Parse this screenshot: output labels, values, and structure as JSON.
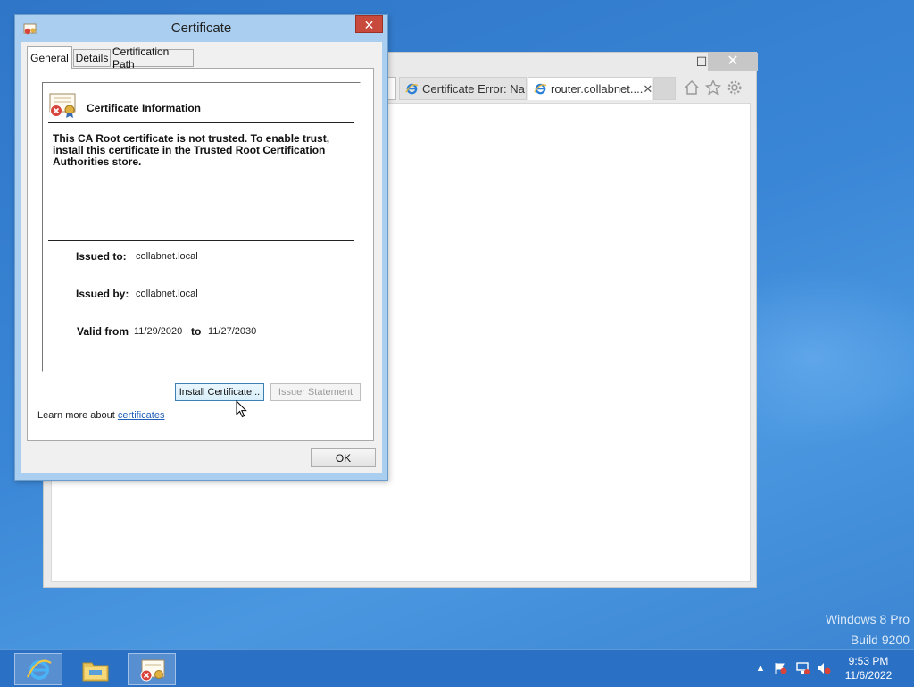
{
  "browser": {
    "tabs": [
      {
        "label": "Certificate Error: Na..."
      },
      {
        "label": "router.collabnet...."
      }
    ],
    "controls": {
      "minimize": "—",
      "maximize": "☐",
      "close": "✕"
    },
    "tab_close": "✕"
  },
  "dialog": {
    "title": "Certificate",
    "close_glyph": "✕",
    "tabs": [
      {
        "label": "General"
      },
      {
        "label": "Details"
      },
      {
        "label": "Certification Path"
      }
    ],
    "info_title": "Certificate Information",
    "info_text": "This CA Root certificate is not trusted. To enable trust, install this certificate in the Trusted Root Certification Authorities store.",
    "issued_to_label": "Issued to:",
    "issued_to_value": "collabnet.local",
    "issued_by_label": "Issued by:",
    "issued_by_value": "collabnet.local",
    "valid_from_label": "Valid from",
    "valid_from_value": "11/29/2020",
    "valid_to_label": "to",
    "valid_to_value": "11/27/2030",
    "install_button": "Install Certificate...",
    "issuer_statement_button": "Issuer Statement",
    "learn_more_prefix": "Learn more about",
    "learn_more_link": "certificates",
    "ok_button": "OK"
  },
  "watermark": {
    "line1": "Windows 8 Pro",
    "line2": "Build 9200"
  },
  "taskbar": {
    "items": [
      {
        "icon": "internet-explorer-icon"
      },
      {
        "icon": "file-explorer-icon"
      },
      {
        "icon": "certificate-app-icon"
      }
    ],
    "clock_time": "9:53 PM",
    "clock_date": "11/6/2022"
  },
  "colors": {
    "desktop": "#3a86d6",
    "taskbar": "#2a70c4",
    "dialog_frame": "#a9ceef",
    "close_red": "#c74a3c",
    "link": "#1f5fb8"
  }
}
